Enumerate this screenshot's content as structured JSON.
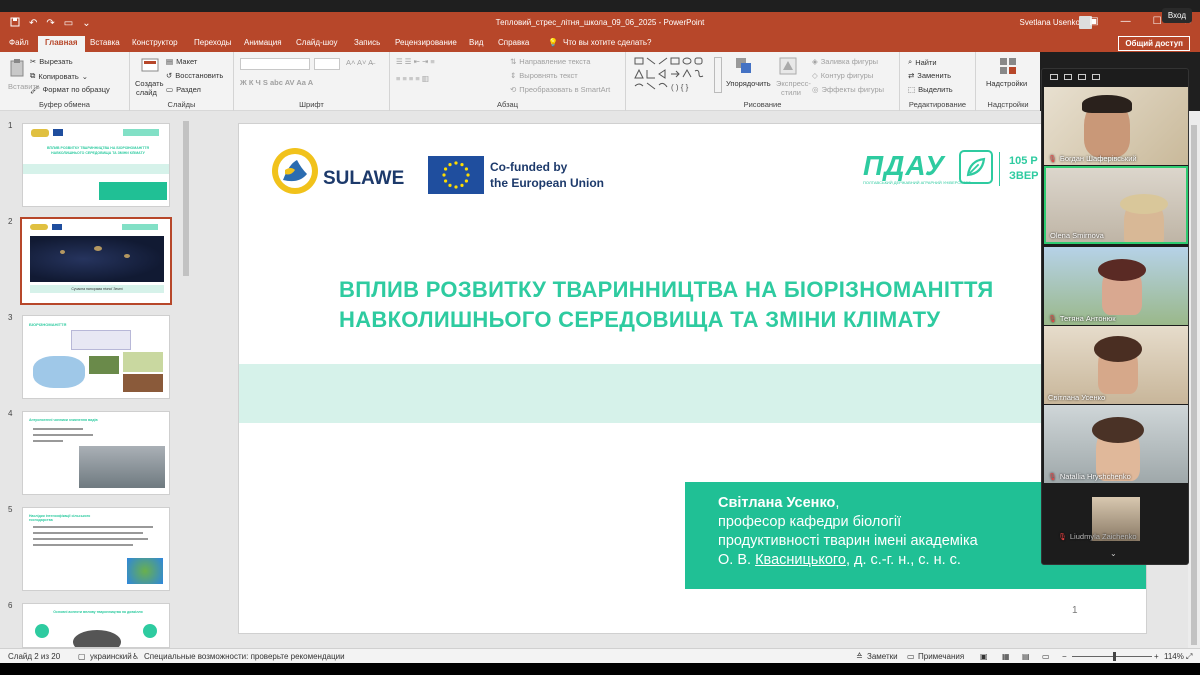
{
  "window": {
    "doc_title": "Тепловий_стрес_літня_школа_09_06_2025 - PowerPoint",
    "user_name": "Svetlana Usenko",
    "login_button": "Вход"
  },
  "tabs": [
    {
      "label": "Файл"
    },
    {
      "label": "Главная"
    },
    {
      "label": "Вставка"
    },
    {
      "label": "Конструктор"
    },
    {
      "label": "Переходы"
    },
    {
      "label": "Анимация"
    },
    {
      "label": "Слайд-шоу"
    },
    {
      "label": "Запись"
    },
    {
      "label": "Рецензирование"
    },
    {
      "label": "Вид"
    },
    {
      "label": "Справка"
    }
  ],
  "tell_me": "Что вы хотите сделать?",
  "share_button": "Общий доступ",
  "ribbon": {
    "clipboard": {
      "paste": "Вставить",
      "cut": "Вырезать",
      "copy": "Копировать",
      "format_painter": "Формат по образцу",
      "title": "Буфер обмена"
    },
    "slides": {
      "new_slide": "Создать",
      "new_slide2": "слайд",
      "layout": "Макет",
      "reset": "Восстановить",
      "section": "Раздел",
      "title": "Слайды"
    },
    "font": {
      "title": "Шрифт"
    },
    "paragraph": {
      "text_direction": "Направление текста",
      "align_text": "Выровнять текст",
      "smartart": "Преобразовать в SmartArt",
      "title": "Абзац"
    },
    "drawing": {
      "arrange": "Упорядочить",
      "quick_styles": "Экспресс-",
      "quick_styles2": "стили",
      "fill": "Заливка фигуры",
      "outline": "Контур фигуры",
      "effects": "Эффекты фигуры",
      "title": "Рисование"
    },
    "editing": {
      "find": "Найти",
      "replace": "Заменить",
      "select": "Выделить",
      "title": "Редактирование"
    },
    "addins": {
      "label": "Надстройки",
      "title": "Надстройки"
    }
  },
  "thumbnails": [
    {
      "num": "1",
      "caption": "ВПЛИВ РОЗВИТКУ ТВАРИННИЦТВА НА БІОРІЗНОМАНІТТЯ НАВКОЛИШНЬОГО СЕРЕДОВИЩА ТА ЗМІНИ КЛІМАТУ"
    },
    {
      "num": "2",
      "caption": "Сучасна панорама нічної Землі"
    },
    {
      "num": "3",
      "caption": "БІОРІЗНОМАНІТТЯ"
    },
    {
      "num": "4",
      "caption": "Антропогенні чинники зникнення видів"
    },
    {
      "num": "5",
      "caption": "Наслідки інтенсифікації сільського господарства"
    },
    {
      "num": "6",
      "caption": "Основні аспекти впливу тваринництва на довкілля"
    }
  ],
  "slide": {
    "logo_text": "SULAWE",
    "eu_line1": "Co-funded by",
    "eu_line2": "the European Union",
    "pdau_logo": "ПДАУ",
    "pdau_sub": "ПОЛТАВСЬКИЙ ДЕРЖАВНИЙ АГРАРНИЙ УНІВЕРСИТЕТ",
    "pdau_years1": "105 Р",
    "pdau_years2": "ЗВЕР",
    "title_line1": "ВПЛИВ РОЗВИТКУ ТВАРИННИЦТВА НА БІОРІЗНОМАНІТТЯ",
    "title_line2": "НАВКОЛИШНЬОГО СЕРЕДОВИЩА ТА ЗМІНИ КЛІМАТУ",
    "author_name": "Світлана Усенко",
    "author_comma": ",",
    "author_line2": "професор кафедри біології",
    "author_line3": "продуктивності тварин імені академіка",
    "author_line4_pre": "О. В. ",
    "author_line4_link": "Квасницького",
    "author_line4_post": ", д. с.-г. н., с. н. с.",
    "page_number": "1"
  },
  "participants": [
    {
      "name": "Богдан Шаферівський",
      "muted": true
    },
    {
      "name": "Olena Smirnova",
      "muted": false
    },
    {
      "name": "Тетяна Антонюк",
      "muted": true
    },
    {
      "name": "Світлана Усенко",
      "muted": false
    },
    {
      "name": "Natallia Hryshchenko",
      "muted": true
    },
    {
      "name": "Liudmyla Zaichenko",
      "muted": true
    }
  ],
  "status": {
    "slide_info": "Слайд 2 из 20",
    "language": "украинский",
    "accessibility": "Специальные возможности: проверьте рекомендации",
    "notes": "Заметки",
    "comments": "Примечания",
    "zoom": "114%"
  },
  "colors": {
    "accent": "#b7472a",
    "teal": "#2ecba0",
    "teal_band": "#d6f2ea",
    "teal_box": "#20c095",
    "eu_blue": "#1f4e9e"
  }
}
